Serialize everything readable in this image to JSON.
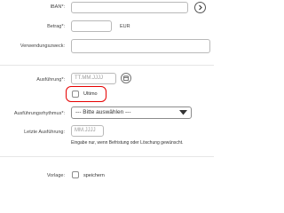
{
  "form": {
    "iban_label": "IBAN*:",
    "betrag_label": "Betrag*:",
    "currency": "EUR",
    "verwendungszweck_label": "Verwendungszweck:",
    "ausfuehrung_label": "Ausführung*:",
    "ausfuehrung_placeholder": "TT.MM.JJJJ",
    "ultimo_label": "Ultimo",
    "rhythmus_label": "Ausführungsrhythmus*:",
    "rhythmus_selected": "--- Bitte auswählen ---",
    "letzte_label": "Letzte Ausführung:",
    "letzte_placeholder": "MM.JJJJ",
    "letzte_hint": "Eingabe nur, wenn Befristung oder Löschung gewünscht.",
    "vorlage_label": "Vorlage:",
    "speichern_label": "speichern"
  },
  "colors": {
    "accent": "#e60000",
    "border": "#b9b9b9"
  },
  "icons": {
    "iban_action": "chevron-right-icon",
    "calendar": "calendar-icon",
    "dropdown": "caret-down-icon"
  }
}
